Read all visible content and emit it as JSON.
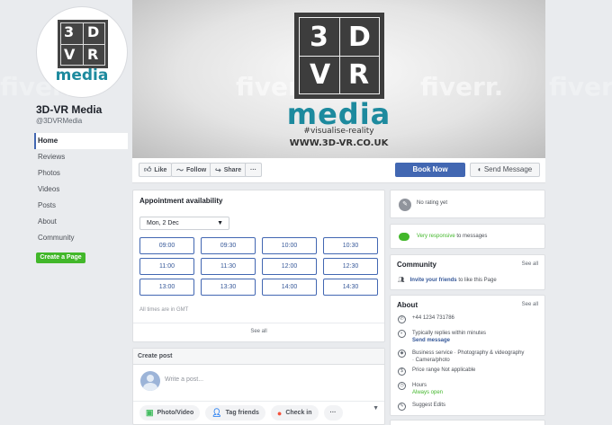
{
  "page": {
    "name": "3D-VR Media",
    "handle": "@3DVRMedia",
    "logo": {
      "letters": [
        "3",
        "D",
        "V",
        "R"
      ],
      "wordmark": "media"
    }
  },
  "cover": {
    "letters": [
      "3",
      "D",
      "V",
      "R"
    ],
    "wordmark": "media",
    "tagline": "#visualise-reality",
    "url": "WWW.3D-VR.CO.UK",
    "watermark": "fiverr."
  },
  "left_nav": {
    "items": [
      "Home",
      "Reviews",
      "Photos",
      "Videos",
      "Posts",
      "About",
      "Community"
    ],
    "create_page": "Create a Page"
  },
  "actions": {
    "like": "Like",
    "follow": "Follow",
    "share": "Share",
    "more": "···",
    "book_now": "Book Now",
    "send_message": "Send Message"
  },
  "appointment": {
    "title": "Appointment availability",
    "date": "Mon, 2 Dec",
    "slots": [
      "09:00",
      "09:30",
      "10:00",
      "10:30",
      "11:00",
      "11:30",
      "12:00",
      "12:30",
      "13:00",
      "13:30",
      "14:00",
      "14:30"
    ],
    "timezone_note": "All times are in GMT",
    "see_all": "See all"
  },
  "create_post": {
    "title": "Create post",
    "placeholder": "Write a post...",
    "actions": [
      "Photo/Video",
      "Tag friends",
      "Check in",
      "···"
    ]
  },
  "rating": {
    "text": "No rating yet"
  },
  "responsive": {
    "highlight": "Very responsive",
    "text": "to messages"
  },
  "community": {
    "title": "Community",
    "see_all": "See all",
    "invite": "Invite your friends",
    "invite_rest": "to like this Page"
  },
  "about": {
    "title": "About",
    "see_all": "See all",
    "phone": "+44 1234 731786",
    "reply_time": "Typically replies within minutes",
    "send_message": "Send message",
    "category_line1": "Business service · Photography & videography",
    "category_line2": "· Camera/photo",
    "price_range": "Price range Not applicable",
    "hours_label": "Hours",
    "hours_status": "Always open",
    "suggest_edits": "Suggest Edits"
  },
  "colors": {
    "facebook_blue": "#4267b2",
    "link_blue": "#365899",
    "green": "#42b72a",
    "brand_teal": "#1d8a9e",
    "page_bg": "#e9ebee"
  }
}
